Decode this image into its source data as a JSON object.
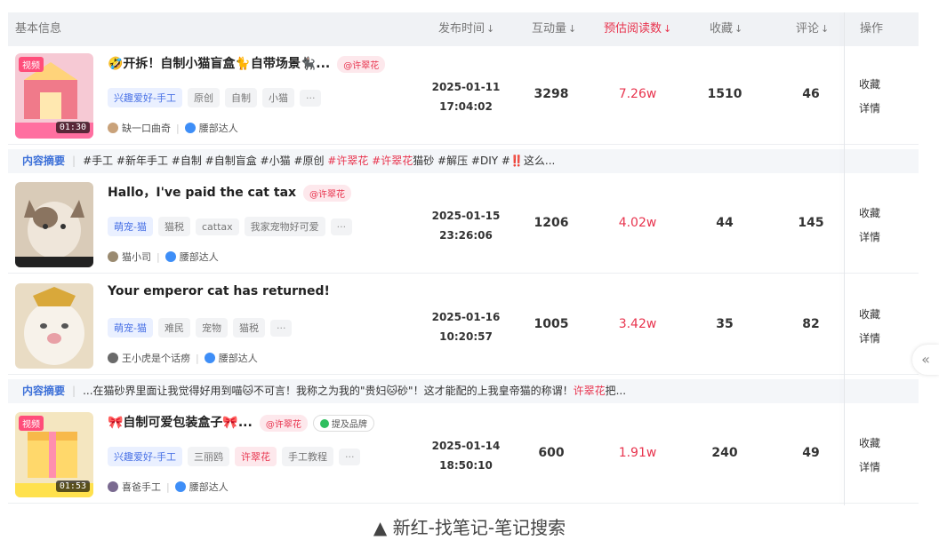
{
  "header": {
    "basic_info": "基本信息",
    "publish_time": "发布时间",
    "interactions": "互动量",
    "est_reads": "预估阅读数",
    "favorites": "收藏",
    "comments": "评论",
    "actions": "操作"
  },
  "rows": [
    {
      "video_tag": "视频",
      "duration": "01:30",
      "title": "🤣开拆！自制小猫盲盒🐈自带场景🐈‍⬛...",
      "mention": "@许翠花",
      "tags": [
        {
          "label": "兴趣爱好-手工",
          "kind": "cat"
        },
        {
          "label": "原创",
          "kind": "plain"
        },
        {
          "label": "自制",
          "kind": "plain"
        },
        {
          "label": "小猫",
          "kind": "plain"
        },
        {
          "label": "···",
          "kind": "more"
        }
      ],
      "author": "缺一口曲奇",
      "level": "腰部达人",
      "date": "2025-01-11",
      "time": "17:04:02",
      "interactions": "3298",
      "reads": "7.26w",
      "favorites": "1510",
      "comments": "46",
      "op_fav": "收藏",
      "op_detail": "详情"
    },
    {
      "title": "Hallo，I've paid the cat tax",
      "mention": "@许翠花",
      "tags": [
        {
          "label": "萌宠-猫",
          "kind": "cat"
        },
        {
          "label": "猫税",
          "kind": "plain"
        },
        {
          "label": "cattax",
          "kind": "plain"
        },
        {
          "label": "我家宠物好可爱",
          "kind": "plain"
        },
        {
          "label": "···",
          "kind": "more"
        }
      ],
      "author": "猫小司",
      "level": "腰部达人",
      "date": "2025-01-15",
      "time": "23:26:06",
      "interactions": "1206",
      "reads": "4.02w",
      "favorites": "44",
      "comments": "145",
      "op_fav": "收藏",
      "op_detail": "详情"
    },
    {
      "title": "Your emperor cat has returned!",
      "tags": [
        {
          "label": "萌宠-猫",
          "kind": "cat"
        },
        {
          "label": "难民",
          "kind": "plain"
        },
        {
          "label": "宠物",
          "kind": "plain"
        },
        {
          "label": "猫税",
          "kind": "plain"
        },
        {
          "label": "···",
          "kind": "more"
        }
      ],
      "author": "王小虎是个话痨",
      "level": "腰部达人",
      "date": "2025-01-16",
      "time": "10:20:57",
      "interactions": "1005",
      "reads": "3.42w",
      "favorites": "35",
      "comments": "82",
      "op_fav": "收藏",
      "op_detail": "详情"
    },
    {
      "video_tag": "视频",
      "duration": "01:53",
      "title": "🎀自制可爱包装盒子🎀...",
      "mention": "@许翠花",
      "brand": "提及品牌",
      "tags": [
        {
          "label": "兴趣爱好-手工",
          "kind": "cat"
        },
        {
          "label": "三丽鸥",
          "kind": "plain"
        },
        {
          "label": "许翠花",
          "kind": "hot"
        },
        {
          "label": "手工教程",
          "kind": "plain"
        },
        {
          "label": "···",
          "kind": "more"
        }
      ],
      "author": "喜爸手工",
      "level": "腰部达人",
      "date": "2025-01-14",
      "time": "18:50:10",
      "interactions": "600",
      "reads": "1.91w",
      "favorites": "240",
      "comments": "49",
      "op_fav": "收藏",
      "op_detail": "详情"
    }
  ],
  "summaries": [
    {
      "label": "内容摘要",
      "p1": "#手工 #新年手工 #自制 #自制盲盒 #小猫 #原创 ",
      "h1": "#许翠花 #许翠花",
      "p2": "猫砂 #解压 #DIY #‼️这么..."
    },
    {
      "label": "内容摘要",
      "p1": "...在猫砂界里面让我觉得好用到喵🐱不可言！我称之为我的\"贵妇🐱砂\"！这才能配的上我皇帝猫的称谓！",
      "h1": "许翠花",
      "p2": "把..."
    }
  ],
  "side_handle": "«",
  "caption": "▲ 新红-找笔记-笔记搜索"
}
